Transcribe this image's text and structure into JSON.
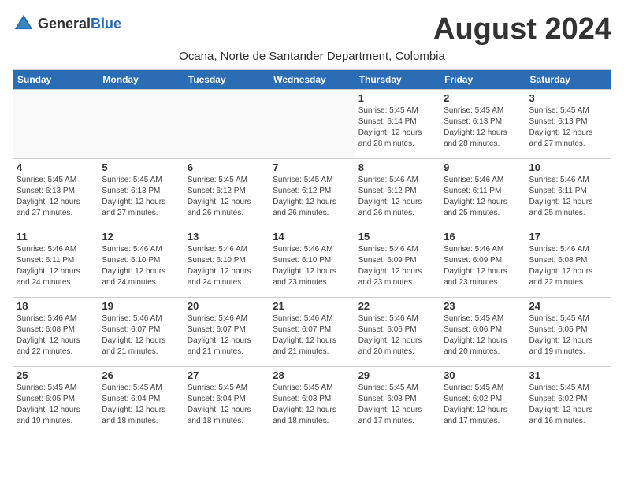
{
  "header": {
    "logo_general": "General",
    "logo_blue": "Blue",
    "month_title": "August 2024",
    "subtitle": "Ocana, Norte de Santander Department, Colombia"
  },
  "days_of_week": [
    "Sunday",
    "Monday",
    "Tuesday",
    "Wednesday",
    "Thursday",
    "Friday",
    "Saturday"
  ],
  "weeks": [
    [
      {
        "day": "",
        "info": ""
      },
      {
        "day": "",
        "info": ""
      },
      {
        "day": "",
        "info": ""
      },
      {
        "day": "",
        "info": ""
      },
      {
        "day": "1",
        "info": "Sunrise: 5:45 AM\nSunset: 6:14 PM\nDaylight: 12 hours\nand 28 minutes."
      },
      {
        "day": "2",
        "info": "Sunrise: 5:45 AM\nSunset: 6:13 PM\nDaylight: 12 hours\nand 28 minutes."
      },
      {
        "day": "3",
        "info": "Sunrise: 5:45 AM\nSunset: 6:13 PM\nDaylight: 12 hours\nand 27 minutes."
      }
    ],
    [
      {
        "day": "4",
        "info": "Sunrise: 5:45 AM\nSunset: 6:13 PM\nDaylight: 12 hours\nand 27 minutes."
      },
      {
        "day": "5",
        "info": "Sunrise: 5:45 AM\nSunset: 6:13 PM\nDaylight: 12 hours\nand 27 minutes."
      },
      {
        "day": "6",
        "info": "Sunrise: 5:45 AM\nSunset: 6:12 PM\nDaylight: 12 hours\nand 26 minutes."
      },
      {
        "day": "7",
        "info": "Sunrise: 5:45 AM\nSunset: 6:12 PM\nDaylight: 12 hours\nand 26 minutes."
      },
      {
        "day": "8",
        "info": "Sunrise: 5:46 AM\nSunset: 6:12 PM\nDaylight: 12 hours\nand 26 minutes."
      },
      {
        "day": "9",
        "info": "Sunrise: 5:46 AM\nSunset: 6:11 PM\nDaylight: 12 hours\nand 25 minutes."
      },
      {
        "day": "10",
        "info": "Sunrise: 5:46 AM\nSunset: 6:11 PM\nDaylight: 12 hours\nand 25 minutes."
      }
    ],
    [
      {
        "day": "11",
        "info": "Sunrise: 5:46 AM\nSunset: 6:11 PM\nDaylight: 12 hours\nand 24 minutes."
      },
      {
        "day": "12",
        "info": "Sunrise: 5:46 AM\nSunset: 6:10 PM\nDaylight: 12 hours\nand 24 minutes."
      },
      {
        "day": "13",
        "info": "Sunrise: 5:46 AM\nSunset: 6:10 PM\nDaylight: 12 hours\nand 24 minutes."
      },
      {
        "day": "14",
        "info": "Sunrise: 5:46 AM\nSunset: 6:10 PM\nDaylight: 12 hours\nand 23 minutes."
      },
      {
        "day": "15",
        "info": "Sunrise: 5:46 AM\nSunset: 6:09 PM\nDaylight: 12 hours\nand 23 minutes."
      },
      {
        "day": "16",
        "info": "Sunrise: 5:46 AM\nSunset: 6:09 PM\nDaylight: 12 hours\nand 23 minutes."
      },
      {
        "day": "17",
        "info": "Sunrise: 5:46 AM\nSunset: 6:08 PM\nDaylight: 12 hours\nand 22 minutes."
      }
    ],
    [
      {
        "day": "18",
        "info": "Sunrise: 5:46 AM\nSunset: 6:08 PM\nDaylight: 12 hours\nand 22 minutes."
      },
      {
        "day": "19",
        "info": "Sunrise: 5:46 AM\nSunset: 6:07 PM\nDaylight: 12 hours\nand 21 minutes."
      },
      {
        "day": "20",
        "info": "Sunrise: 5:46 AM\nSunset: 6:07 PM\nDaylight: 12 hours\nand 21 minutes."
      },
      {
        "day": "21",
        "info": "Sunrise: 5:46 AM\nSunset: 6:07 PM\nDaylight: 12 hours\nand 21 minutes."
      },
      {
        "day": "22",
        "info": "Sunrise: 5:46 AM\nSunset: 6:06 PM\nDaylight: 12 hours\nand 20 minutes."
      },
      {
        "day": "23",
        "info": "Sunrise: 5:45 AM\nSunset: 6:06 PM\nDaylight: 12 hours\nand 20 minutes."
      },
      {
        "day": "24",
        "info": "Sunrise: 5:45 AM\nSunset: 6:05 PM\nDaylight: 12 hours\nand 19 minutes."
      }
    ],
    [
      {
        "day": "25",
        "info": "Sunrise: 5:45 AM\nSunset: 6:05 PM\nDaylight: 12 hours\nand 19 minutes."
      },
      {
        "day": "26",
        "info": "Sunrise: 5:45 AM\nSunset: 6:04 PM\nDaylight: 12 hours\nand 18 minutes."
      },
      {
        "day": "27",
        "info": "Sunrise: 5:45 AM\nSunset: 6:04 PM\nDaylight: 12 hours\nand 18 minutes."
      },
      {
        "day": "28",
        "info": "Sunrise: 5:45 AM\nSunset: 6:03 PM\nDaylight: 12 hours\nand 18 minutes."
      },
      {
        "day": "29",
        "info": "Sunrise: 5:45 AM\nSunset: 6:03 PM\nDaylight: 12 hours\nand 17 minutes."
      },
      {
        "day": "30",
        "info": "Sunrise: 5:45 AM\nSunset: 6:02 PM\nDaylight: 12 hours\nand 17 minutes."
      },
      {
        "day": "31",
        "info": "Sunrise: 5:45 AM\nSunset: 6:02 PM\nDaylight: 12 hours\nand 16 minutes."
      }
    ]
  ]
}
